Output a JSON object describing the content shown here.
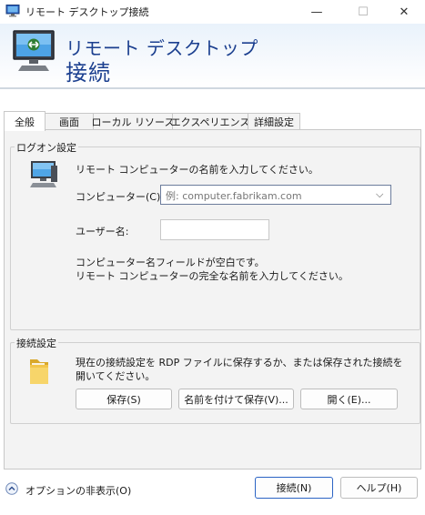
{
  "window": {
    "title": "リモート デスクトップ接続",
    "controls": {
      "minimize": "—",
      "maximize": "☐",
      "close": "✕"
    }
  },
  "banner": {
    "line1": "リモート デスクトップ",
    "line2": "接続"
  },
  "tabs": [
    {
      "label": "全般",
      "active": true
    },
    {
      "label": "画面",
      "active": false
    },
    {
      "label": "ローカル リソース",
      "active": false
    },
    {
      "label": "エクスペリエンス",
      "active": false
    },
    {
      "label": "詳細設定",
      "active": false
    }
  ],
  "logon": {
    "legend": "ログオン設定",
    "instruction": "リモート コンピューターの名前を入力してください。",
    "computer_label": "コンピューター(C):",
    "computer_placeholder": "例: computer.fabrikam.com",
    "username_label": "ユーザー名:",
    "username_value": "",
    "message_line1": "コンピューター名フィールドが空白です。",
    "message_line2": "リモート コンピューターの完全な名前を入力してください。"
  },
  "connection": {
    "legend": "接続設定",
    "description_line1": "現在の接続設定を RDP ファイルに保存するか、または保存された接続を",
    "description_line2": "開いてください。",
    "save_label": "保存(S)",
    "save_as_label": "名前を付けて保存(V)...",
    "open_label": "開く(E)..."
  },
  "footer": {
    "options_label": "オプションの非表示(O)",
    "connect_label": "接続(N)",
    "help_label": "ヘルプ(H)"
  },
  "colors": {
    "banner_text": "#1b3f8f",
    "accent_border": "#2a63c4"
  },
  "icons": {
    "app": "remote-desktop-icon",
    "banner": "remote-desktop-icon",
    "logon": "computer-icon",
    "connection": "folder-icon",
    "options": "chevron-up-icon",
    "combo": "chevron-down-icon"
  }
}
